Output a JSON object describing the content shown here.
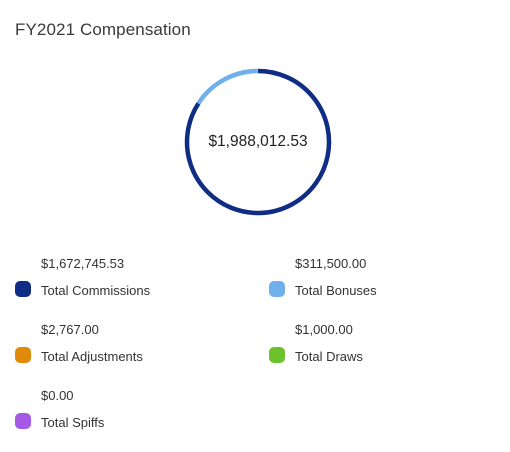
{
  "card": {
    "title": "FY2021 Compensation"
  },
  "chart_data": {
    "type": "pie",
    "variant": "donut",
    "title": "FY2021 Compensation",
    "center_label": "$1,988,012.53",
    "total": 1988012.53,
    "categories": [
      "Total Commissions",
      "Total Bonuses",
      "Total Adjustments",
      "Total Draws",
      "Total Spiffs"
    ],
    "values": [
      1672745.53,
      311500.0,
      2767.0,
      1000.0,
      0.0
    ],
    "value_labels": [
      "$1,672,745.53",
      "$311,500.00",
      "$2,767.00",
      "$1,000.00",
      "$0.00"
    ],
    "colors": [
      "#0f2d84",
      "#6fb0ec",
      "#e08a0a",
      "#6cc22a",
      "#a55ae6"
    ],
    "legend": "below, two columns"
  }
}
